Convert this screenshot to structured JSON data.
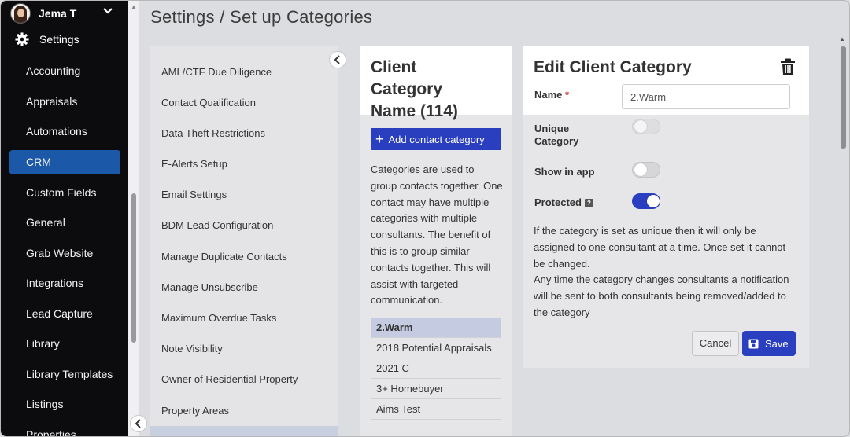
{
  "user": {
    "name": "Jema T"
  },
  "nav": {
    "settings_label": "Settings",
    "items": [
      {
        "label": "Accounting"
      },
      {
        "label": "Appraisals"
      },
      {
        "label": "Automations"
      },
      {
        "label": "CRM",
        "active": true
      },
      {
        "label": "Custom Fields"
      },
      {
        "label": "General"
      },
      {
        "label": "Grab Website"
      },
      {
        "label": "Integrations"
      },
      {
        "label": "Lead Capture"
      },
      {
        "label": "Library"
      },
      {
        "label": "Library Templates"
      },
      {
        "label": "Listings"
      },
      {
        "label": "Properties"
      }
    ]
  },
  "page_title": "Settings / Set up Categories",
  "crm_menu": [
    "AML/CTF Due Diligence",
    "Contact Qualification",
    "Data Theft Restrictions",
    "E-Alerts Setup",
    "Email Settings",
    "BDM Lead Configuration",
    "Manage Duplicate Contacts",
    "Manage Unsubscribe",
    "Maximum Overdue Tasks",
    "Note Visibility",
    "Owner of Residential Property",
    "Property Areas"
  ],
  "client_categories": {
    "title_line1": "Client",
    "title_line2": "Category",
    "title_line3": "Name (114)",
    "add_button": "Add contact category",
    "description": "Categories are used to group contacts together. One contact may have multiple categories with multiple consultants. The benefit of this is to group similar contacts together. This will assist with targeted communication.",
    "items": [
      {
        "label": "2.Warm",
        "selected": true
      },
      {
        "label": "2018 Potential Appraisals"
      },
      {
        "label": "2021 C"
      },
      {
        "label": "3+ Homebuyer"
      },
      {
        "label": "Aims Test"
      }
    ]
  },
  "edit": {
    "title": "Edit Client Category",
    "name_label": "Name",
    "required_mark": "*",
    "name_value": "2.Warm",
    "unique_label_1": "Unique",
    "unique_label_2": "Category",
    "show_in_app_label": "Show in app",
    "protected_label": "Protected",
    "toggles": {
      "unique": false,
      "show_in_app": false,
      "protected": true
    },
    "info_1": "If the category is set as unique then it will only be assigned to one consultant at a time. Once set it cannot be changed.",
    "info_2": "Any time the category changes consultants a notification will be sent to both consultants being removed/added to the category",
    "cancel_label": "Cancel",
    "save_label": "Save"
  },
  "colors": {
    "primary": "#2a3fbf",
    "nav_bg": "#0c0c0f",
    "nav_active": "#1c58a8"
  }
}
